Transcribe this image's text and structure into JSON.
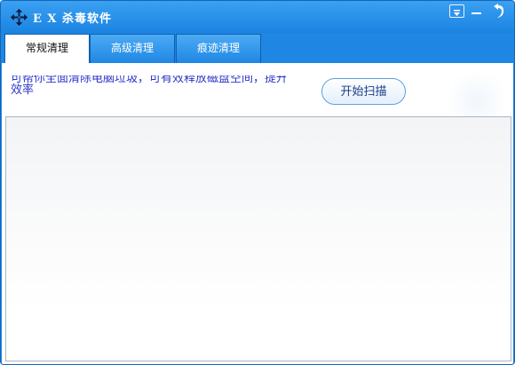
{
  "window": {
    "title": "E X 杀毒软件",
    "accent_color": "#1f86e3",
    "icons": {
      "app": "move-arrows-icon",
      "menu": "dropdown-menu-icon",
      "minimize": "minimize-icon",
      "close": "back-arrow-close-icon"
    }
  },
  "tabs": [
    {
      "label": "常规清理",
      "active": true
    },
    {
      "label": "高级清理",
      "active": false
    },
    {
      "label": "痕迹清理",
      "active": false
    }
  ],
  "panel": {
    "description_line1": "可帮你全面清除电脑垃圾，可有效释放磁盘空间，提升",
    "description_line2": "效率",
    "scan_button": "开始扫描"
  }
}
